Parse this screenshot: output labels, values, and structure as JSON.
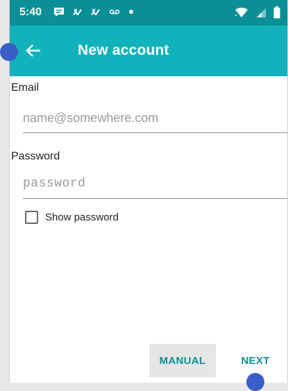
{
  "status_bar": {
    "time": "5:40",
    "icons": [
      "message-icon",
      "missed-call-icon",
      "missed-call-icon",
      "voicemail-icon",
      "dot-icon"
    ],
    "right_icons": [
      "wifi-icon",
      "signal-icon",
      "battery-icon"
    ]
  },
  "app_bar": {
    "title": "New account"
  },
  "form": {
    "email_label": "Email",
    "email_placeholder": "name@somewhere.com",
    "password_label": "Password",
    "password_placeholder": "password",
    "show_password_label": "Show password"
  },
  "actions": {
    "manual_label": "MANUAL",
    "next_label": "NEXT"
  },
  "colors": {
    "status_bar": "#0b8f97",
    "app_bar": "#12b2bc",
    "accent": "#0b8f97",
    "touch_indicator": "#3a5ec9"
  }
}
